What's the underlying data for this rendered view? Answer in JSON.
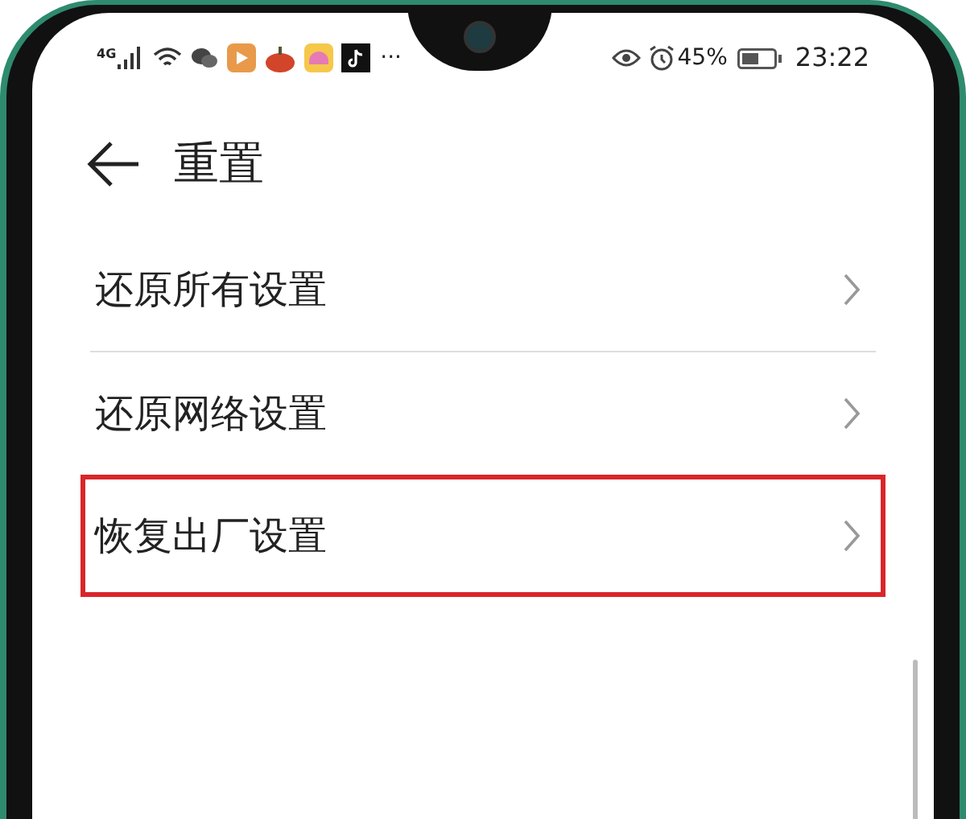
{
  "status_bar": {
    "network": "4G",
    "more": "···",
    "battery": "45%",
    "time": "23:22"
  },
  "header": {
    "title": "重置"
  },
  "items": [
    {
      "label": "还原所有设置",
      "highlighted": false
    },
    {
      "label": "还原网络设置",
      "highlighted": false
    },
    {
      "label": "恢复出厂设置",
      "highlighted": true
    }
  ]
}
